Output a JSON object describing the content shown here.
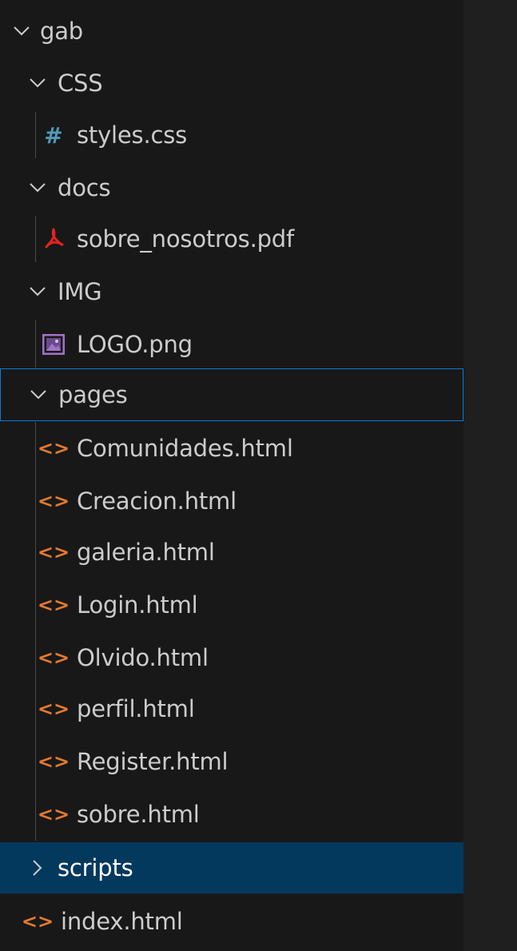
{
  "explorer": {
    "root": {
      "label": "gab",
      "state": "expanded"
    },
    "folders": {
      "css": {
        "label": "CSS",
        "state": "expanded"
      },
      "docs": {
        "label": "docs",
        "state": "expanded"
      },
      "img": {
        "label": "IMG",
        "state": "expanded"
      },
      "pages": {
        "label": "pages",
        "state": "expanded"
      },
      "scripts": {
        "label": "scripts",
        "state": "collapsed"
      }
    },
    "files": {
      "styles": {
        "label": "styles.css",
        "icon": "hash-icon"
      },
      "sobre_nosotros": {
        "label": "sobre_nosotros.pdf",
        "icon": "pdf-icon"
      },
      "logo": {
        "label": "LOGO.png",
        "icon": "image-icon"
      },
      "pages": [
        {
          "label": "Comunidades.html"
        },
        {
          "label": "Creacion.html"
        },
        {
          "label": "galeria.html"
        },
        {
          "label": "Login.html"
        },
        {
          "label": "Olvido.html"
        },
        {
          "label": "perfil.html"
        },
        {
          "label": "Register.html"
        },
        {
          "label": "sobre.html"
        }
      ],
      "index": {
        "label": "index.html",
        "icon": "html-icon"
      }
    }
  },
  "colors": {
    "background": "#181818",
    "text": "#cccccc",
    "html_icon": "#e37933",
    "css_icon": "#519aba",
    "pdf_icon": "#e42222",
    "image_icon": "#a074c4",
    "focus_border": "#0a7ad6",
    "selected_bg": "#04395e"
  }
}
